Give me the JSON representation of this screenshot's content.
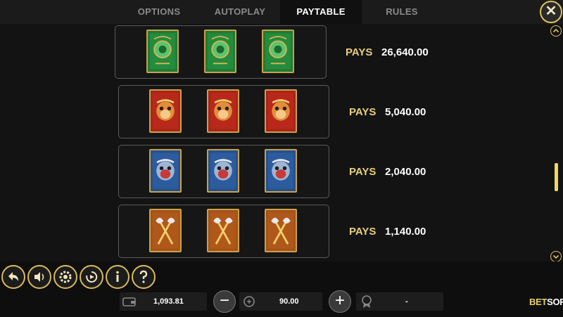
{
  "tabs": [
    {
      "label": "OPTIONS"
    },
    {
      "label": "AUTOPLAY"
    },
    {
      "label": "PAYTABLE"
    },
    {
      "label": "RULES"
    }
  ],
  "active_tab": "PAYTABLE",
  "close_label": "✕",
  "paytable": [
    {
      "symbol": "jade-dragon-symbol",
      "pays_label": "PAYS",
      "pays_value": "26,640.00",
      "color": "#1e8a3a"
    },
    {
      "symbol": "red-monkey-mask-symbol",
      "pays_label": "PAYS",
      "pays_value": "5,040.00",
      "color": "#b3261a"
    },
    {
      "symbol": "blue-monkey-mask-symbol",
      "pays_label": "PAYS",
      "pays_value": "2,040.00",
      "color": "#2a5a9a"
    },
    {
      "symbol": "golden-axes-symbol",
      "pays_label": "PAYS",
      "pays_value": "1,140.00",
      "color": "#b0581a"
    }
  ],
  "bottom": {
    "balance": "1,093.81",
    "bet": "90.00",
    "win": "-",
    "minus": "−",
    "plus": "+"
  },
  "logo": {
    "bet": "BET",
    "soft": "SOFT"
  },
  "colors": {
    "accent": "#e7cf7a",
    "gold_border": "#c9a24a"
  }
}
